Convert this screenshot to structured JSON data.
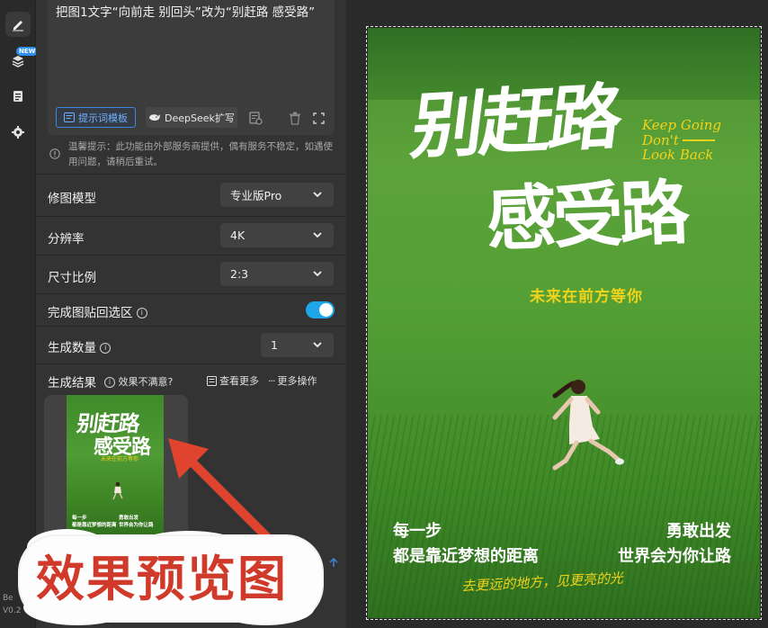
{
  "rail": {
    "new_badge": "NEW",
    "version_line1": "Be",
    "version_line2": "V0.2"
  },
  "prompt": {
    "text": "把图1文字“向前走 别回头”改为“别赶路 感受路”",
    "template_button": "提示词模板",
    "deepseek_button": "DeepSeek扩写"
  },
  "notice": {
    "text": "温馨提示：此功能由外部服务商提供，偶有服务不稳定，如遇使用问题，请稍后重试。"
  },
  "settings": {
    "model_label": "修图模型",
    "model_value": "专业版Pro",
    "resolution_label": "分辨率",
    "resolution_value": "4K",
    "ratio_label": "尺寸比例",
    "ratio_value": "2:3",
    "paste_back_label": "完成图贴回选区",
    "paste_back_on": true,
    "count_label": "生成数量",
    "count_value": "1"
  },
  "results": {
    "label": "生成结果",
    "unsatisfied": "效果不满意?",
    "see_more": "查看更多",
    "more_actions": "更多操作"
  },
  "annotation": {
    "sticker_text": "效果预览图",
    "arrow_color": "#e0442f"
  },
  "poster": {
    "title_line1": "别赶路",
    "title_line2": "感受路",
    "english_line1": "Keep Going",
    "english_line2": "Don't",
    "english_line3": "Look Back",
    "subtitle": "未来在前方等你",
    "left_line1": "每一步",
    "left_line2": "都是靠近梦想的距离",
    "right_line1": "勇敢出发",
    "right_line2": "世界会为你让路",
    "signature": "去更远的地方，见更亮的光",
    "accent_color": "#f2d31b"
  },
  "thumbnail": {
    "title_line1": "别赶路",
    "title_line2": "感受路",
    "subtitle": "未来在前方等你",
    "left_line1": "每一步",
    "left_line2": "都是靠近梦想的距离",
    "right_line1": "勇敢出发",
    "right_line2": "世界会为你让路"
  }
}
